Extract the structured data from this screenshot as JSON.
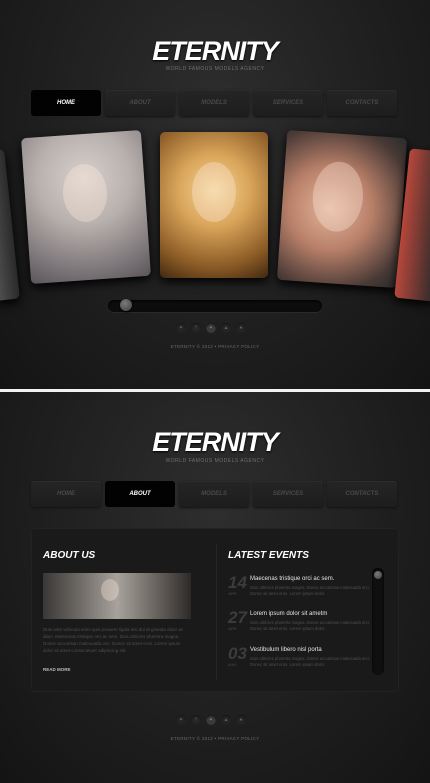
{
  "brand": {
    "logo": "ETERNITY",
    "tagline": "WORLD FAMOUS MODELS AGENCY"
  },
  "nav": {
    "items": [
      {
        "label": "HOME"
      },
      {
        "label": "ABOUT"
      },
      {
        "label": "MODELS"
      },
      {
        "label": "SERVICES"
      },
      {
        "label": "CONTACTS"
      }
    ]
  },
  "panel1": {
    "active_nav": "HOME"
  },
  "panel2": {
    "active_nav": "ABOUT"
  },
  "slider": {
    "position_fraction": 0.06
  },
  "social": {
    "icons": [
      "bird-icon",
      "facebook-icon",
      "plus-icon",
      "triangle-icon",
      "circle-icon"
    ]
  },
  "footer": {
    "brand_year": "ETERNITY © 2012",
    "separator": "•",
    "privacy": "PRIVACY POLICY"
  },
  "about": {
    "title": "ABOUT US",
    "text": "Duis ante vehicula enim quis posuere ligula nisi dui at gravida dolor ac diam. Maecenas tristique orci ac sem. Duis ultricies pharetra magna. Donec accumsan malesuada orci. Donec sit amet eros. Lorem ipsum dolor sit amet consectetuer adipiscing elit.",
    "read_more": "READ MORE"
  },
  "events": {
    "title": "LATEST EVENTS",
    "items": [
      {
        "day": "14",
        "month": "APR",
        "title": "Maecenas tristique orci ac sem.",
        "desc": "Duis ultricies pharetra magna. Donec accumsan malesuada orci. Donec sit amet eros. Lorem ipsum dolor."
      },
      {
        "day": "27",
        "month": "APR",
        "title": "Lorem ipsum dolor sit ametm",
        "desc": "Duis ultricies pharetra magna. Donec accumsan malesuada orci. Donec sit amet eros. Lorem ipsum dolor."
      },
      {
        "day": "03",
        "month": "MAY",
        "title": "Vestibulum libero nisl porta",
        "desc": "Duis ultricies pharetra magna. Donec accumsan malesuada orci. Donec sit amet eros. Lorem ipsum dolor."
      }
    ]
  }
}
